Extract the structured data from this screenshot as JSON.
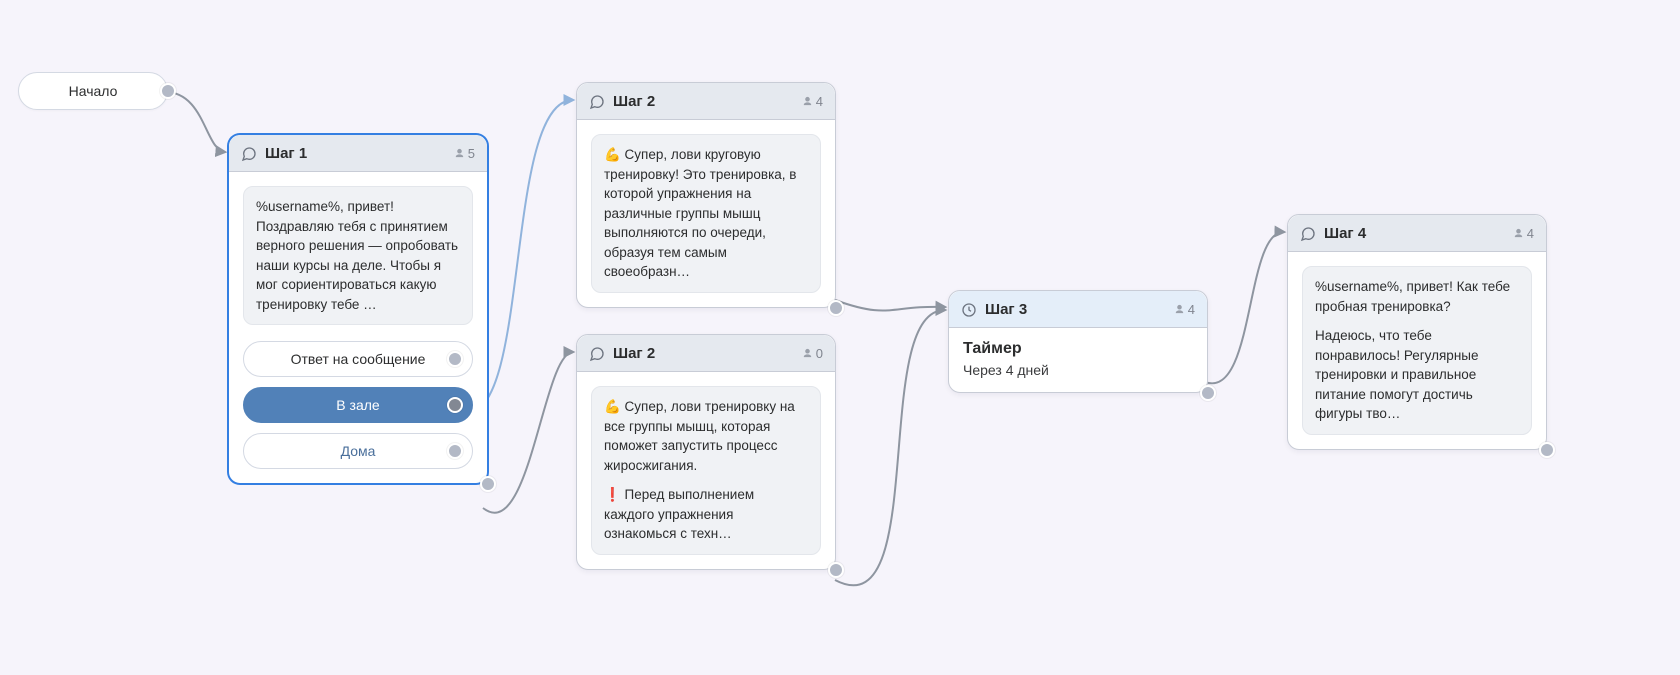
{
  "start": {
    "label": "Начало"
  },
  "steps": {
    "s1": {
      "title": "Шаг 1",
      "count": 5,
      "message": "%username%, привет! Поздравляю тебя с принятием верного решения — опробовать наши курсы на деле. Чтобы я мог сориентироваться какую тренировку тебе …",
      "options": {
        "reply": "Ответ на сообщение",
        "gym": "В зале",
        "home": "Дома"
      }
    },
    "s2a": {
      "title": "Шаг 2",
      "count": 4,
      "message": "💪 Супер, лови круговую тренировку! Это тренировка, в которой упражнения на различные группы мышц выполняются по очереди, образуя тем самым своеобразн…"
    },
    "s2b": {
      "title": "Шаг 2",
      "count": 0,
      "message_p1": "💪  Супер, лови тренировку на все группы мышц, которая поможет запустить процесс жиросжигания.",
      "message_p2": "❗ Перед выполнением каждого упражнения ознакомься с техн…"
    },
    "s3": {
      "title": "Шаг 3",
      "count": 4,
      "timer_title": "Таймер",
      "timer_sub": "Через 4 дней"
    },
    "s4": {
      "title": "Шаг 4",
      "count": 4,
      "message_p1": "%username%, привет! Как тебе пробная тренировка?",
      "message_p2": "Надеюсь, что тебе понравилось! Регулярные тренировки и правильное питание помогут достичь фигуры тво…"
    }
  }
}
